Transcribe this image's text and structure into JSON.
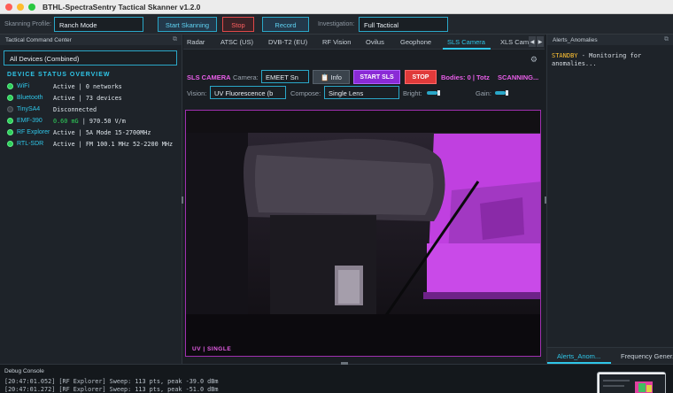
{
  "window": {
    "title": "BTHL-SpectraSentry Tactical Skanner v1.2.0"
  },
  "toolbar": {
    "profile_label": "Skanning Profile:",
    "profile_value": "Ranch Mode",
    "start_label": "Start Skanning",
    "stop_label": "Stop",
    "record_label": "Record",
    "investigation_label": "Investigation:",
    "investigation_value": "Full Tactical"
  },
  "left_panel": {
    "header": "Tactical Command Center",
    "device_select": "All Devices (Combined)",
    "section_title": "DEVICE STATUS OVERVIEW",
    "devices": [
      {
        "name": "WiFi",
        "status": "Active | 0 networks",
        "active": true
      },
      {
        "name": "Bluetooth",
        "status": "Active | 73 devices",
        "active": true
      },
      {
        "name": "TinySA4",
        "status": "Disconnected",
        "active": false
      },
      {
        "name": "EMF-390",
        "status_mg": "0.60 mG",
        "status_rest": " | 970.50 V/m",
        "active": true
      },
      {
        "name": "RF Explorer",
        "status": "Active | 5A Mode  15-2700MHz",
        "active": true
      },
      {
        "name": "RTL-SDR",
        "status": "Active | FM 100.1 MHz  52-2200 MHz",
        "active": true
      }
    ]
  },
  "center": {
    "tabs": [
      "Radar",
      "ATSC (US)",
      "DVB-T2 (EU)",
      "RF Vision",
      "Ovilus",
      "Geophone",
      "SLS Camera",
      "XLS Cam"
    ],
    "active_tab": "SLS Camera",
    "sls_title": "SLS CAMERA",
    "camera_label": "Camera:",
    "camera_value": "EMEET Sn",
    "info_label": "Info",
    "start_sls_label": "START SLS",
    "stop_label": "STOP",
    "bodies_text": "Bodies: 0 | Totz",
    "scanning_text": "SCANNING...",
    "vision_label": "Vision:",
    "vision_value": "UV Fluorescence (b",
    "compose_label": "Compose:",
    "compose_value": "Single Lens",
    "bright_label": "Bright:",
    "gain_label": "Gain:",
    "overlay_text": "UV | SINGLE"
  },
  "right_panel": {
    "header": "Alerts_Anomalies",
    "status_word": "STANDBY",
    "status_message": " - Monitoring for anomalies...",
    "tabs": [
      "Alerts_Anom...",
      "Frequency Gener..."
    ]
  },
  "console": {
    "header": "Debug Console",
    "lines": [
      "[20:47:01.052] [RF Explorer] Sweep: 113 pts, peak -39.0 dBm",
      "[20:47:01.272] [RF Explorer] Sweep: 113 pts, peak -51.0 dBm"
    ]
  },
  "colors": {
    "accent": "#2fc6e8",
    "magenta": "#e85ee8",
    "stop_red": "#e03a3a",
    "active_green": "#2fcf5a",
    "standby_yellow": "#ffc233",
    "uv_purple": "#c040e0"
  }
}
